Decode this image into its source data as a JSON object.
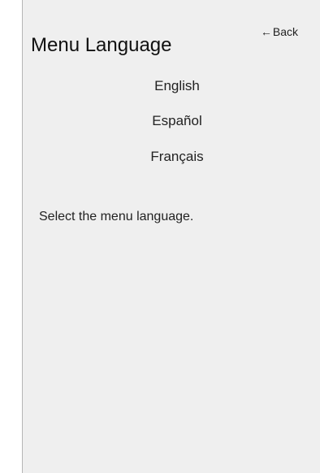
{
  "header": {
    "title": "Menu Language",
    "back_label": "Back"
  },
  "languages": [
    {
      "label": "English"
    },
    {
      "label": "Español"
    },
    {
      "label": "Français"
    }
  ],
  "description": "Select the menu language.",
  "icons": {
    "back": "left-arrow-icon"
  }
}
